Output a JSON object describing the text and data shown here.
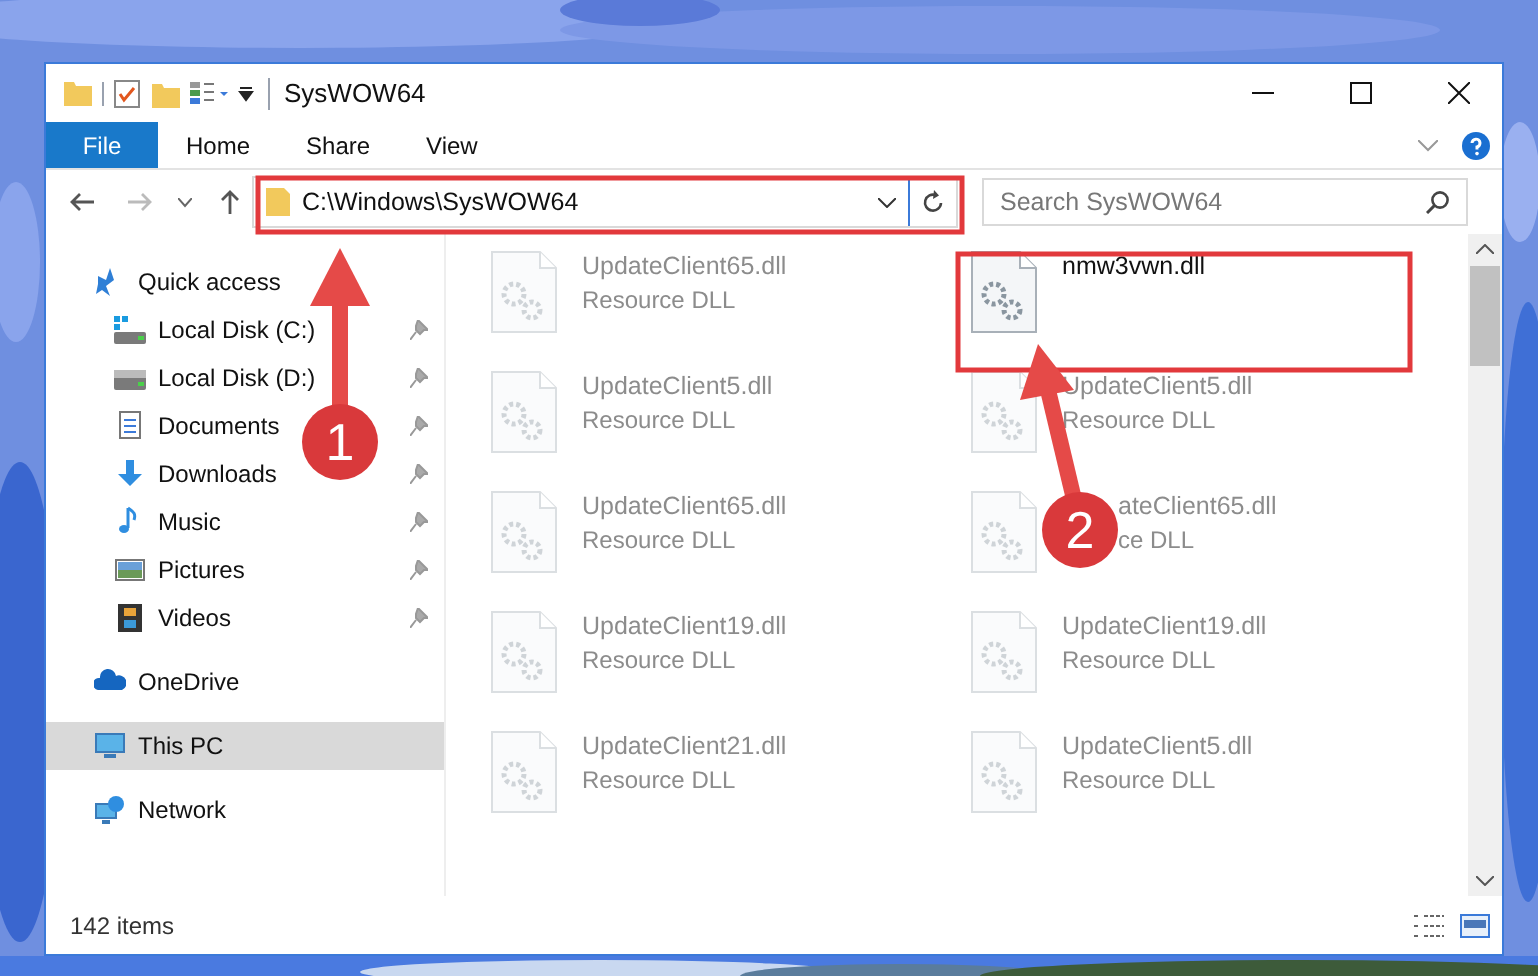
{
  "window": {
    "title": "SysWOW64"
  },
  "ribbon_tabs": [
    {
      "label": "File",
      "kind": "file"
    },
    {
      "label": "Home",
      "kind": "tab"
    },
    {
      "label": "Share",
      "kind": "tab"
    },
    {
      "label": "View",
      "kind": "tab"
    }
  ],
  "address_bar": {
    "path": "C:\\Windows\\SysWOW64"
  },
  "search": {
    "placeholder": "Search SysWOW64"
  },
  "sidebar": {
    "items": [
      {
        "label": "Quick access",
        "kind": "quick",
        "selected": false,
        "children": [
          {
            "label": "Local Disk (C:)",
            "kind": "disk-c",
            "pinned": true
          },
          {
            "label": "Local Disk (D:)",
            "kind": "disk",
            "pinned": true
          },
          {
            "label": "Documents",
            "kind": "documents",
            "pinned": true
          },
          {
            "label": "Downloads",
            "kind": "downloads",
            "pinned": true
          },
          {
            "label": "Music",
            "kind": "music",
            "pinned": true
          },
          {
            "label": "Pictures",
            "kind": "pictures",
            "pinned": true
          },
          {
            "label": "Videos",
            "kind": "videos",
            "pinned": true
          }
        ]
      },
      {
        "label": "OneDrive",
        "kind": "onedrive",
        "selected": false
      },
      {
        "label": "This PC",
        "kind": "pc",
        "selected": true
      },
      {
        "label": "Network",
        "kind": "network",
        "selected": false
      }
    ]
  },
  "files": [
    {
      "name": "UpdateClient65.dll",
      "type": "Resource DLL",
      "blurred": true
    },
    {
      "name": "nmw3vwn.dll",
      "blurred": false
    },
    {
      "name": "UpdateClient5.dll",
      "type": "Resource DLL",
      "blurred": true
    },
    {
      "name": "UpdateClient5.dll",
      "type": "Resource DLL",
      "blurred": true
    },
    {
      "name": "UpdateClient65.dll",
      "type": "Resource DLL",
      "blurred": true
    },
    {
      "name": "ateClient65.dll",
      "type": "ce DLL",
      "blurred": true,
      "covered": true
    },
    {
      "name": "UpdateClient19.dll",
      "type": "Resource DLL",
      "blurred": true
    },
    {
      "name": "UpdateClient19.dll",
      "type": "Resource DLL",
      "blurred": true
    },
    {
      "name": "UpdateClient21.dll",
      "type": "Resource DLL",
      "blurred": true
    },
    {
      "name": "UpdateClient5.dll",
      "type": "Resource DLL",
      "blurred": true
    }
  ],
  "status_bar": {
    "item_count": "142 items"
  },
  "annotations": [
    {
      "label": "1"
    },
    {
      "label": "2"
    }
  ]
}
